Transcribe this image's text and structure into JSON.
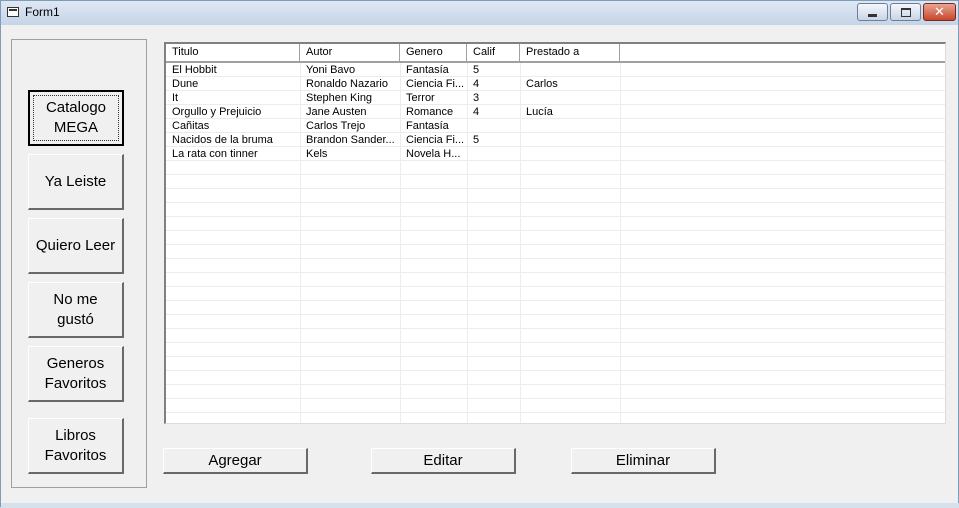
{
  "window": {
    "title": "Form1"
  },
  "nav": [
    {
      "label": "Catalogo\nMEGA",
      "active": true
    },
    {
      "label": "Ya Leiste"
    },
    {
      "label": "Quiero Leer"
    },
    {
      "label": "No me\ngustó"
    },
    {
      "label": "Generos\nFavoritos"
    },
    {
      "label": "Libros\nFavoritos"
    }
  ],
  "table": {
    "columns": [
      "Titulo",
      "Autor",
      "Genero",
      "Calif",
      "Prestado a"
    ],
    "rows": [
      [
        "El Hobbit",
        "Yoni Bavo",
        "Fantasía",
        "5",
        ""
      ],
      [
        "Dune",
        "Ronaldo Nazario",
        "Ciencia Fi...",
        "4",
        "Carlos"
      ],
      [
        "It",
        "Stephen King",
        "Terror",
        "3",
        ""
      ],
      [
        "Orgullo y Prejuicio",
        "Jane Austen",
        "Romance",
        "4",
        "Lucía"
      ],
      [
        "Cañitas",
        "Carlos Trejo",
        "Fantasía",
        "",
        ""
      ],
      [
        "Nacidos de la bruma",
        "Brandon Sander...",
        "Ciencia Fi...",
        "5",
        ""
      ],
      [
        "La rata con tinner",
        "Kels",
        "Novela H...",
        "",
        ""
      ]
    ]
  },
  "actions": {
    "add": "Agregar",
    "edit": "Editar",
    "delete": "Eliminar"
  }
}
